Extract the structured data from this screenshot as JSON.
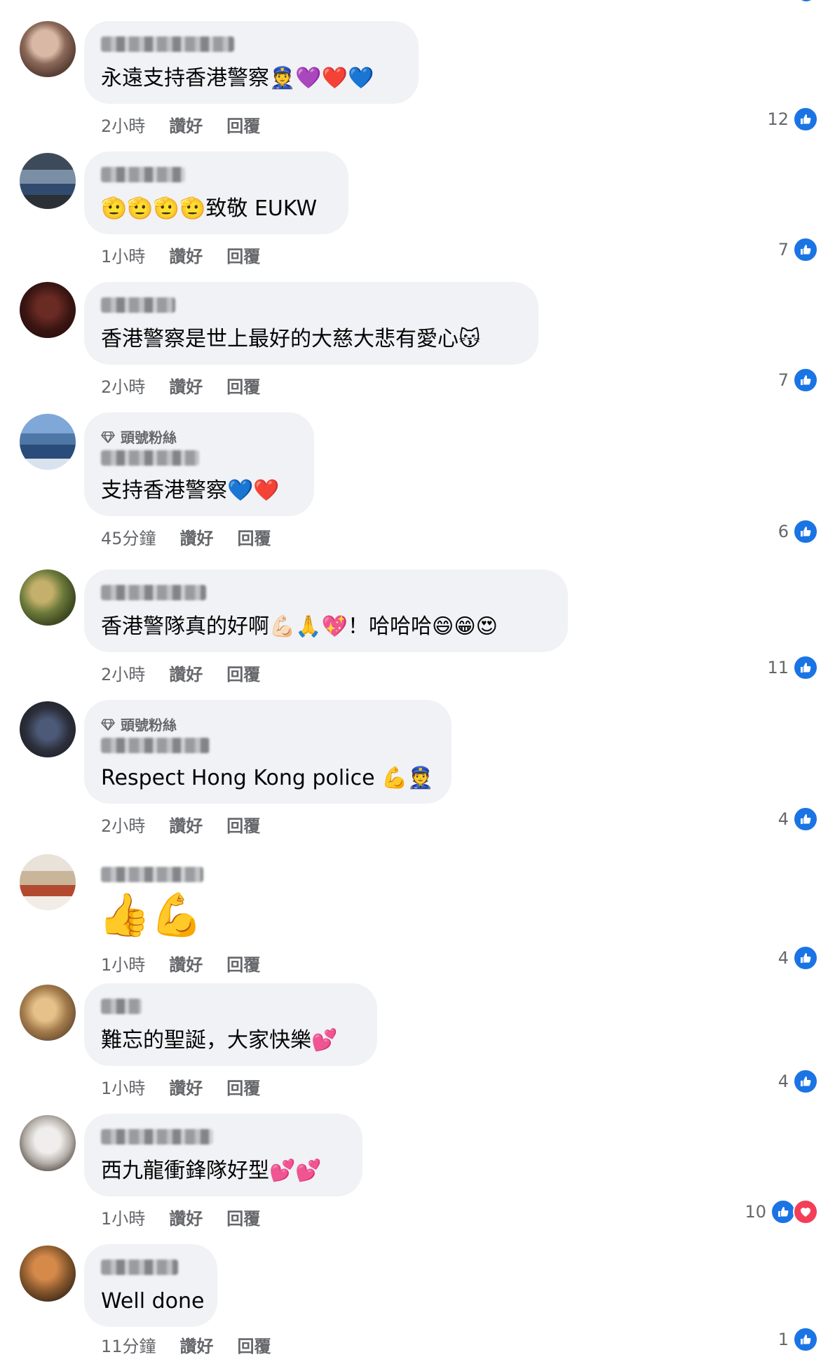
{
  "actions": {
    "like_label": "讚好",
    "reply_label": "回覆"
  },
  "badge_label": "頭號粉絲",
  "comments": [
    {
      "text": "永遠支持香港警察👮💜❤️💙",
      "time": "2小時",
      "likes": "12",
      "reactions": [
        "like"
      ]
    },
    {
      "text": "🫡🫡🫡🫡致敬 EUKW",
      "time": "1小時",
      "likes": "7",
      "reactions": [
        "like"
      ]
    },
    {
      "text": "香港警察是世上最好的大慈大悲有愛心😽",
      "time": "2小時",
      "likes": "7",
      "reactions": [
        "like"
      ]
    },
    {
      "text": "支持香港警察💙❤️",
      "time": "45分鐘",
      "likes": "6",
      "reactions": [
        "like"
      ],
      "badge": true
    },
    {
      "text": "香港警隊真的好啊💪🏻🙏💖！哈哈哈😄😁😍",
      "time": "2小時",
      "likes": "11",
      "reactions": [
        "like"
      ]
    },
    {
      "text": "Respect Hong Kong police 💪👮",
      "time": "2小時",
      "likes": "4",
      "reactions": [
        "like"
      ],
      "badge": true
    },
    {
      "text": "👍💪",
      "time": "1小時",
      "likes": "4",
      "reactions": [
        "like"
      ]
    },
    {
      "text": "難忘的聖誕，大家快樂💕",
      "time": "1小時",
      "likes": "4",
      "reactions": [
        "like"
      ]
    },
    {
      "text": "西九龍衝鋒隊好型💕💕",
      "time": "1小時",
      "likes": "10",
      "reactions": [
        "like",
        "love"
      ]
    },
    {
      "text": "Well done",
      "time": "11分鐘",
      "likes": "1",
      "reactions": [
        "like"
      ]
    }
  ],
  "colors": {
    "like": "#1b74e4",
    "love": "#f33e58",
    "bubble": "#f0f2f5",
    "meta": "#65676b"
  },
  "icons": {
    "like": "thumbs-up-icon",
    "love": "heart-icon",
    "badge": "diamond-icon"
  }
}
